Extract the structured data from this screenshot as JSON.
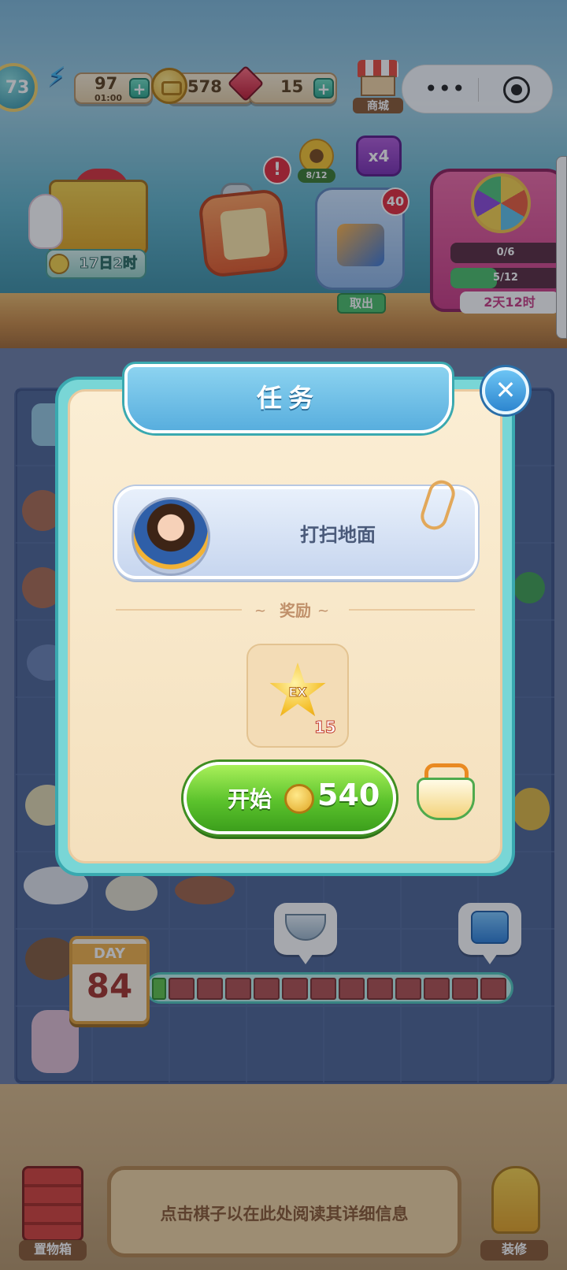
{
  "hud": {
    "level": "73",
    "energy": "97",
    "energy_timer": "01:00",
    "coins": "578",
    "gems": "15",
    "shop_label": "商城",
    "plus": "+"
  },
  "events": {
    "gift_timer": "17日2时",
    "alert": "!",
    "sunflower_progress": "8/12",
    "multiplier": "x4",
    "storage_count": "40",
    "storage_label": "取出",
    "wheel_row1": "0/6",
    "wheel_row2": "5/12",
    "wheel_timer": "2天12时"
  },
  "modal": {
    "title": "任务",
    "close": "✕",
    "task_name": "打扫地面",
    "reward_label": "奖励",
    "reward_ex": "EX",
    "reward_count": "15",
    "start_label": "开始",
    "start_cost": "540"
  },
  "progress": {
    "day_label": "DAY",
    "day_number": "84",
    "cells_total": 12,
    "cells_filled": 0
  },
  "bottom": {
    "toolbox_label": "置物箱",
    "info_text": "点击棋子以在此处阅读其详细信息",
    "decorate_label": "装修"
  },
  "colors": {
    "modal_frame": "#79d6d6",
    "banner": "#58aede",
    "start_button": "#5bc22c",
    "board": "#4d6495"
  }
}
